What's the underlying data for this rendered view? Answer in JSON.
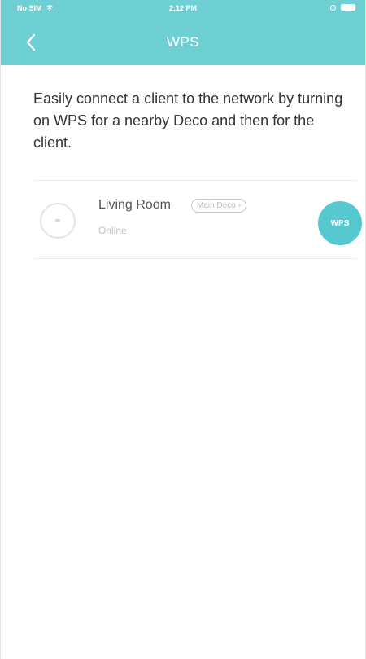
{
  "status_bar": {
    "carrier": "No SIM",
    "time": "2:12 PM"
  },
  "nav": {
    "title": "WPS"
  },
  "description": "Easily connect a client to the network by turning on WPS for a nearby Deco and then for the client.",
  "device": {
    "name": "Living Room",
    "badge": "Main Deco",
    "status": "Online",
    "wps_label": "WPS"
  },
  "colors": {
    "header": "#6fd0d4",
    "accent": "#56c8cf"
  }
}
